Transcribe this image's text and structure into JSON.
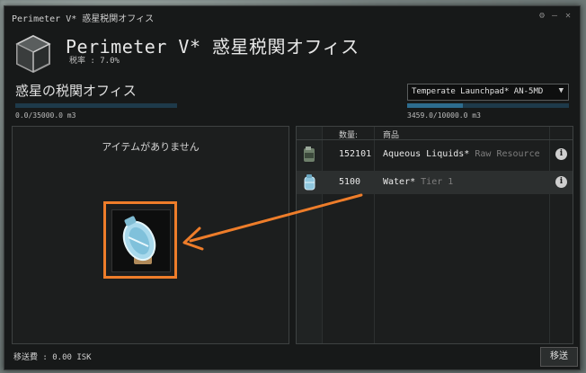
{
  "window": {
    "title": "Perimeter V* 惑星税関オフィス",
    "settings_glyph": "⚙",
    "minimize_glyph": "–",
    "close_glyph": "✕"
  },
  "header": {
    "station_name": "Perimeter V* 惑星税関オフィス",
    "tax_rate": "税率 : 7.0%"
  },
  "customs": {
    "section_title": "惑星の税関オフィス",
    "capacity_text": "0.0/35000.0 m3",
    "capacity_fraction": 0.0,
    "empty_message": "アイテムがありません"
  },
  "launchpad": {
    "selected": "Temperate Launchpad* AN-5MD",
    "capacity_text": "3459.0/10000.0 m3",
    "capacity_fraction": 0.346,
    "columns": [
      "数量:",
      "商品"
    ],
    "items": [
      {
        "qty": "152101",
        "name": "Aqueous Liquids*",
        "category": "Raw Resource",
        "icon": "aqueous-liquids-icon"
      },
      {
        "qty": "5100",
        "name": "Water*",
        "category": "Tier 1",
        "icon": "water-icon"
      }
    ]
  },
  "footer": {
    "transfer_cost": "移送費 : 0.00 ISK",
    "transfer_button": "移送"
  },
  "colors": {
    "accent_arrow": "#ee7d2a",
    "capacity_fill": "#2d6c8e"
  }
}
